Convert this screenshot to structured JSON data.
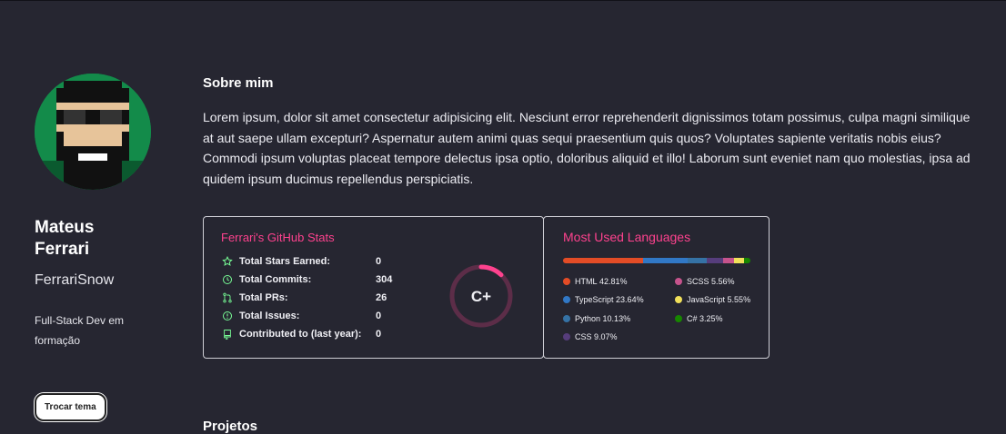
{
  "profile": {
    "name": "Mateus Ferrari",
    "username": "FerrariSnow",
    "tagline": "Full-Stack Dev em formação",
    "theme_button": "Trocar tema",
    "avatar_bg": "#138b4a"
  },
  "about": {
    "title": "Sobre mim",
    "text": "Lorem ipsum, dolor sit amet consectetur adipisicing elit. Nesciunt error reprehenderit dignissimos totam possimus, culpa magni similique at aut saepe ullam excepturi? Aspernatur autem animi quas sequi praesentium quis quos? Voluptates sapiente veritatis nobis eius? Commodi ipsum voluptas placeat tempore delectus ipsa optio, doloribus aliquid et illo! Laborum sunt eveniet nam quo molestias, ipsa ad quidem ipsum ducimus repellendus perspiciatis."
  },
  "stats": {
    "title": "Ferrari's GitHub Stats",
    "rows": [
      {
        "label": "Total Stars Earned:",
        "value": "0",
        "icon": "star-icon"
      },
      {
        "label": "Total Commits:",
        "value": "304",
        "icon": "history-icon"
      },
      {
        "label": "Total PRs:",
        "value": "26",
        "icon": "pull-request-icon"
      },
      {
        "label": "Total Issues:",
        "value": "0",
        "icon": "issue-icon"
      },
      {
        "label": "Contributed to (last year):",
        "value": "0",
        "icon": "repo-icon"
      }
    ],
    "rank": "C+",
    "rank_progress": 0.12,
    "accent": "#fe428e"
  },
  "languages": {
    "title": "Most Used Languages",
    "items": [
      {
        "name": "HTML",
        "percent": "42.81%",
        "value": 42.81,
        "color": "#e34c26"
      },
      {
        "name": "TypeScript",
        "percent": "23.64%",
        "value": 23.64,
        "color": "#3178c6"
      },
      {
        "name": "Python",
        "percent": "10.13%",
        "value": 10.13,
        "color": "#3572a5"
      },
      {
        "name": "CSS",
        "percent": "9.07%",
        "value": 9.07,
        "color": "#563d7c"
      },
      {
        "name": "SCSS",
        "percent": "5.56%",
        "value": 5.56,
        "color": "#c6538c"
      },
      {
        "name": "JavaScript",
        "percent": "5.55%",
        "value": 5.55,
        "color": "#f1e05a"
      },
      {
        "name": "C#",
        "percent": "3.25%",
        "value": 3.25,
        "color": "#178600"
      }
    ]
  },
  "next_section": "Projetos"
}
